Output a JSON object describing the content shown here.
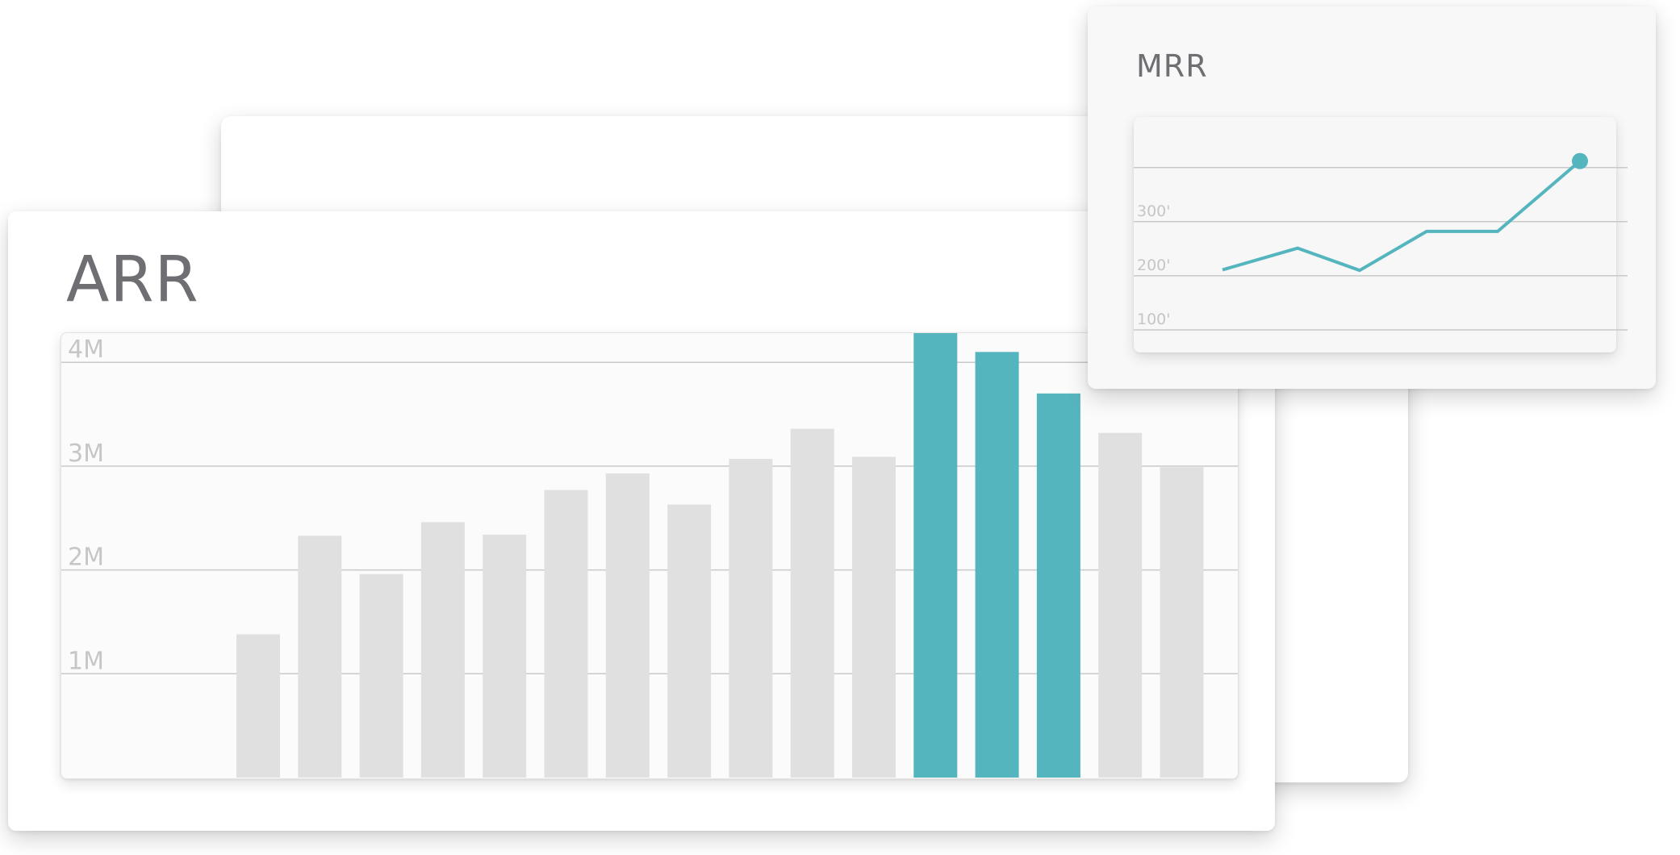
{
  "back_card": {},
  "arr": {
    "title": "ARR"
  },
  "mrr": {
    "title": "MRR"
  },
  "colors": {
    "highlight": "#55b5be",
    "muted_bar": "#e0e0e0",
    "grid": "#c9c9c9",
    "tick": "#c6c6c6",
    "title": "#6e6e73"
  },
  "chart_data": [
    {
      "type": "bar",
      "title": "ARR",
      "xlabel": "",
      "ylabel": "",
      "ylim": [
        0,
        4.7
      ],
      "yticks": [
        1,
        2,
        3,
        4
      ],
      "ytick_labels": [
        "1M",
        "2M",
        "3M",
        "4M"
      ],
      "grid": true,
      "values": [
        1.38,
        2.33,
        1.96,
        2.46,
        2.34,
        2.77,
        2.93,
        2.63,
        3.07,
        3.36,
        3.09,
        4.84,
        4.1,
        3.7,
        3.32,
        2.99
      ],
      "highlighted_indices": [
        11,
        12,
        13
      ]
    },
    {
      "type": "line",
      "title": "MRR",
      "xlabel": "",
      "ylabel": "",
      "ylim": [
        100,
        400
      ],
      "yticks": [
        100,
        200,
        300
      ],
      "ytick_labels": [
        "100'",
        "200'",
        "300'"
      ],
      "grid": true,
      "x": [
        0,
        1,
        2,
        3,
        4,
        5
      ],
      "values": [
        211,
        251,
        210,
        282,
        282,
        412
      ],
      "endpoint_marker": true
    }
  ]
}
